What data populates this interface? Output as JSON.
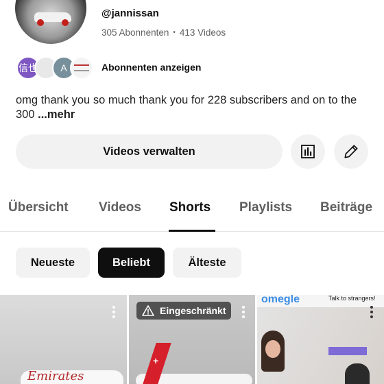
{
  "channel": {
    "handle": "@jannissan",
    "subscribers": "305 Abonnenten",
    "separator": "•",
    "videos": "413 Videos",
    "subscriber_avatars": [
      {
        "text": "信也",
        "color": "#7e57c2"
      },
      {
        "text": "",
        "color": "#e8e8e8"
      },
      {
        "text": "A",
        "color": "#78909c"
      },
      {
        "text": "",
        "color": "#f4f4f4"
      }
    ],
    "show_subscribers_label": "Abonnenten anzeigen",
    "description": "omg thank you so much thank you for 228 subscribers and on to the 300",
    "more_label": "...mehr"
  },
  "actions": {
    "manage_videos_label": "Videos verwalten",
    "stats_icon": "bar-chart-icon",
    "edit_icon": "pencil-icon"
  },
  "tabs": [
    {
      "label": "Übersicht",
      "active": false
    },
    {
      "label": "Videos",
      "active": false
    },
    {
      "label": "Shorts",
      "active": true
    },
    {
      "label": "Playlists",
      "active": false
    },
    {
      "label": "Beiträge",
      "active": false
    }
  ],
  "filters": [
    {
      "label": "Neueste",
      "active": false
    },
    {
      "label": "Beliebt",
      "active": true
    },
    {
      "label": "Älteste",
      "active": false
    }
  ],
  "shorts": [
    {
      "overlay_text": "Emirates"
    },
    {
      "badge": "Eingeschränkt",
      "badge_icon": "warning-icon"
    },
    {
      "overlay_text": "omegle",
      "overlay_text_2": "Talk to strangers!"
    }
  ],
  "colors": {
    "active_chip_bg": "#0f0f0f",
    "chip_bg": "#f2f2f2",
    "muted_text": "#606060"
  }
}
